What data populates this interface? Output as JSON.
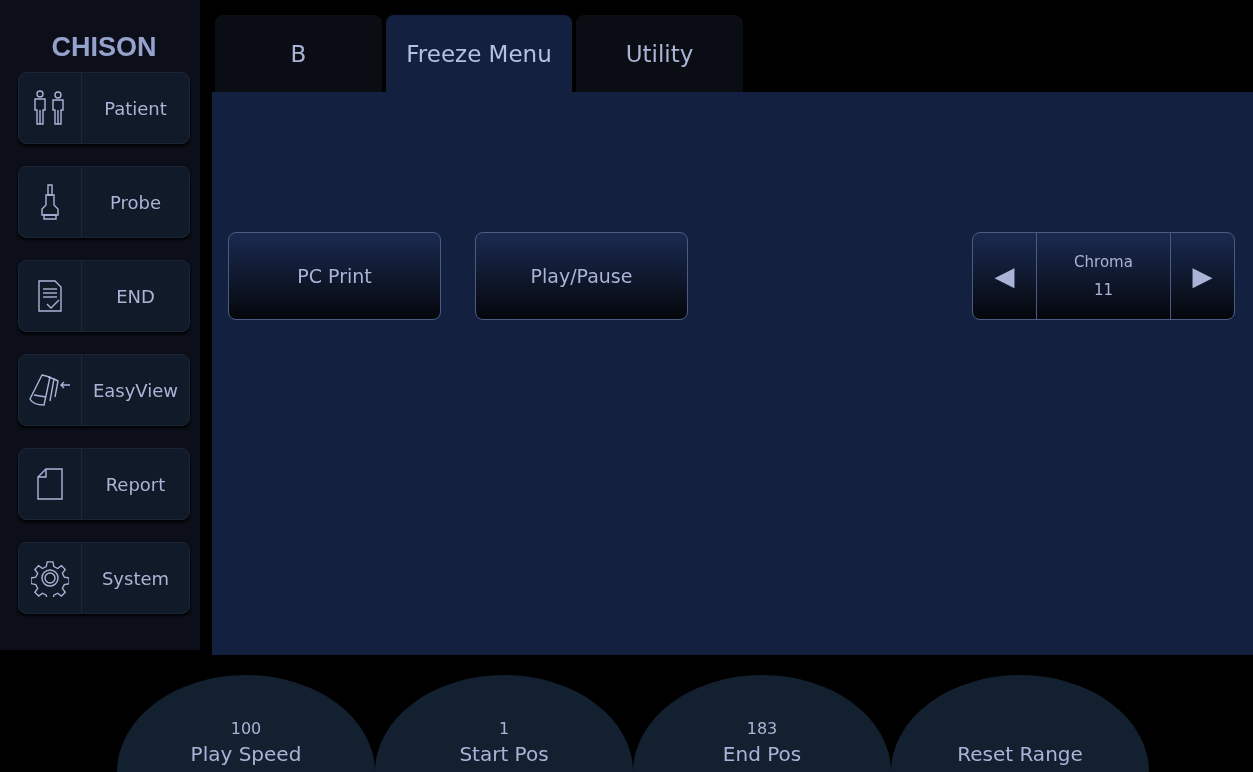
{
  "logo": "CHISON",
  "sidebar": {
    "items": [
      {
        "label": "Patient",
        "kind": "patient"
      },
      {
        "label": "Probe",
        "kind": "probe"
      },
      {
        "label": "END",
        "kind": "checklist"
      },
      {
        "label": "EasyView",
        "kind": "easyview"
      },
      {
        "label": "Report",
        "kind": "document"
      },
      {
        "label": "System",
        "kind": "gear"
      }
    ]
  },
  "tabs": [
    {
      "label": "B",
      "selected": false
    },
    {
      "label": "Freeze Menu",
      "selected": true
    },
    {
      "label": "Utility",
      "selected": false
    }
  ],
  "buttons": [
    "PC Print",
    "Play/Pause"
  ],
  "stepper": {
    "label": "Chroma",
    "value": "11",
    "prev": "◀",
    "next": "▶"
  },
  "knobs": [
    {
      "value": "100",
      "label": "Play Speed"
    },
    {
      "value": "1",
      "label": "Start Pos"
    },
    {
      "value": "183",
      "label": "End Pos"
    },
    {
      "label": "Reset Range"
    }
  ]
}
